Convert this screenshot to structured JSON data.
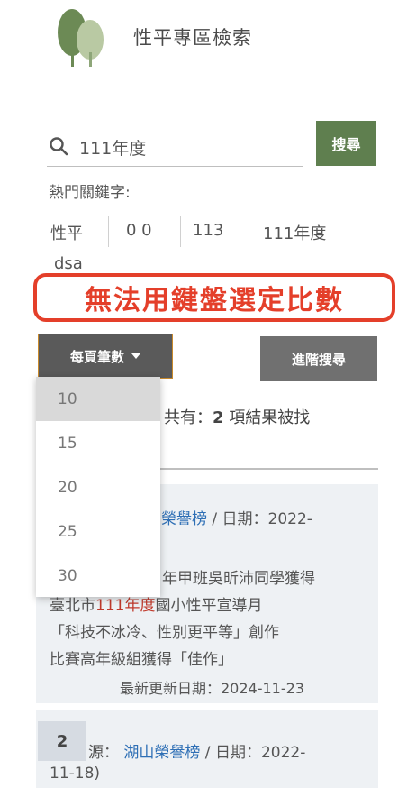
{
  "header": {
    "title": "性平專區檢索"
  },
  "search": {
    "value": "111年度",
    "button_label": "搜尋"
  },
  "hot_keywords": {
    "label": "熱門關鍵字:",
    "items": [
      "性平",
      "0 0",
      "113",
      "111年度",
      "dsa"
    ]
  },
  "annotation": {
    "text": "無法用鍵盤選定比數"
  },
  "per_page": {
    "label": "每頁筆數",
    "options": [
      "10",
      "15",
      "20",
      "25",
      "30"
    ],
    "selected": "10"
  },
  "advanced_search": {
    "label": "進階搜尋"
  },
  "results_summary": {
    "prefix": "共有：",
    "count": "2",
    "suffix": " 項結果被找"
  },
  "results": [
    {
      "category": "榮譽榜",
      "date_text": " / 日期：2022-",
      "line2": "年甲班吳昕沛同學獲得",
      "line3_prefix": "臺北市",
      "line3_highlight": "111年度",
      "line3_suffix": "國小性平宣導月",
      "line4": "「科技不冰冷、性別更平等」創作",
      "line5": "比賽高年級組獲得「佳作」",
      "updated": "最新更新日期：2024-11-23"
    },
    {
      "number": "2",
      "source_label": "源：",
      "category": "湖山榮譽榜",
      "date_text": " / 日期：2022-",
      "date_cont": "11-18)"
    }
  ],
  "colors": {
    "primary_green": "#5f7f4f",
    "alert_red": "#e43f2a",
    "link_blue": "#2e6fb5",
    "highlight_red": "#c0392b"
  }
}
